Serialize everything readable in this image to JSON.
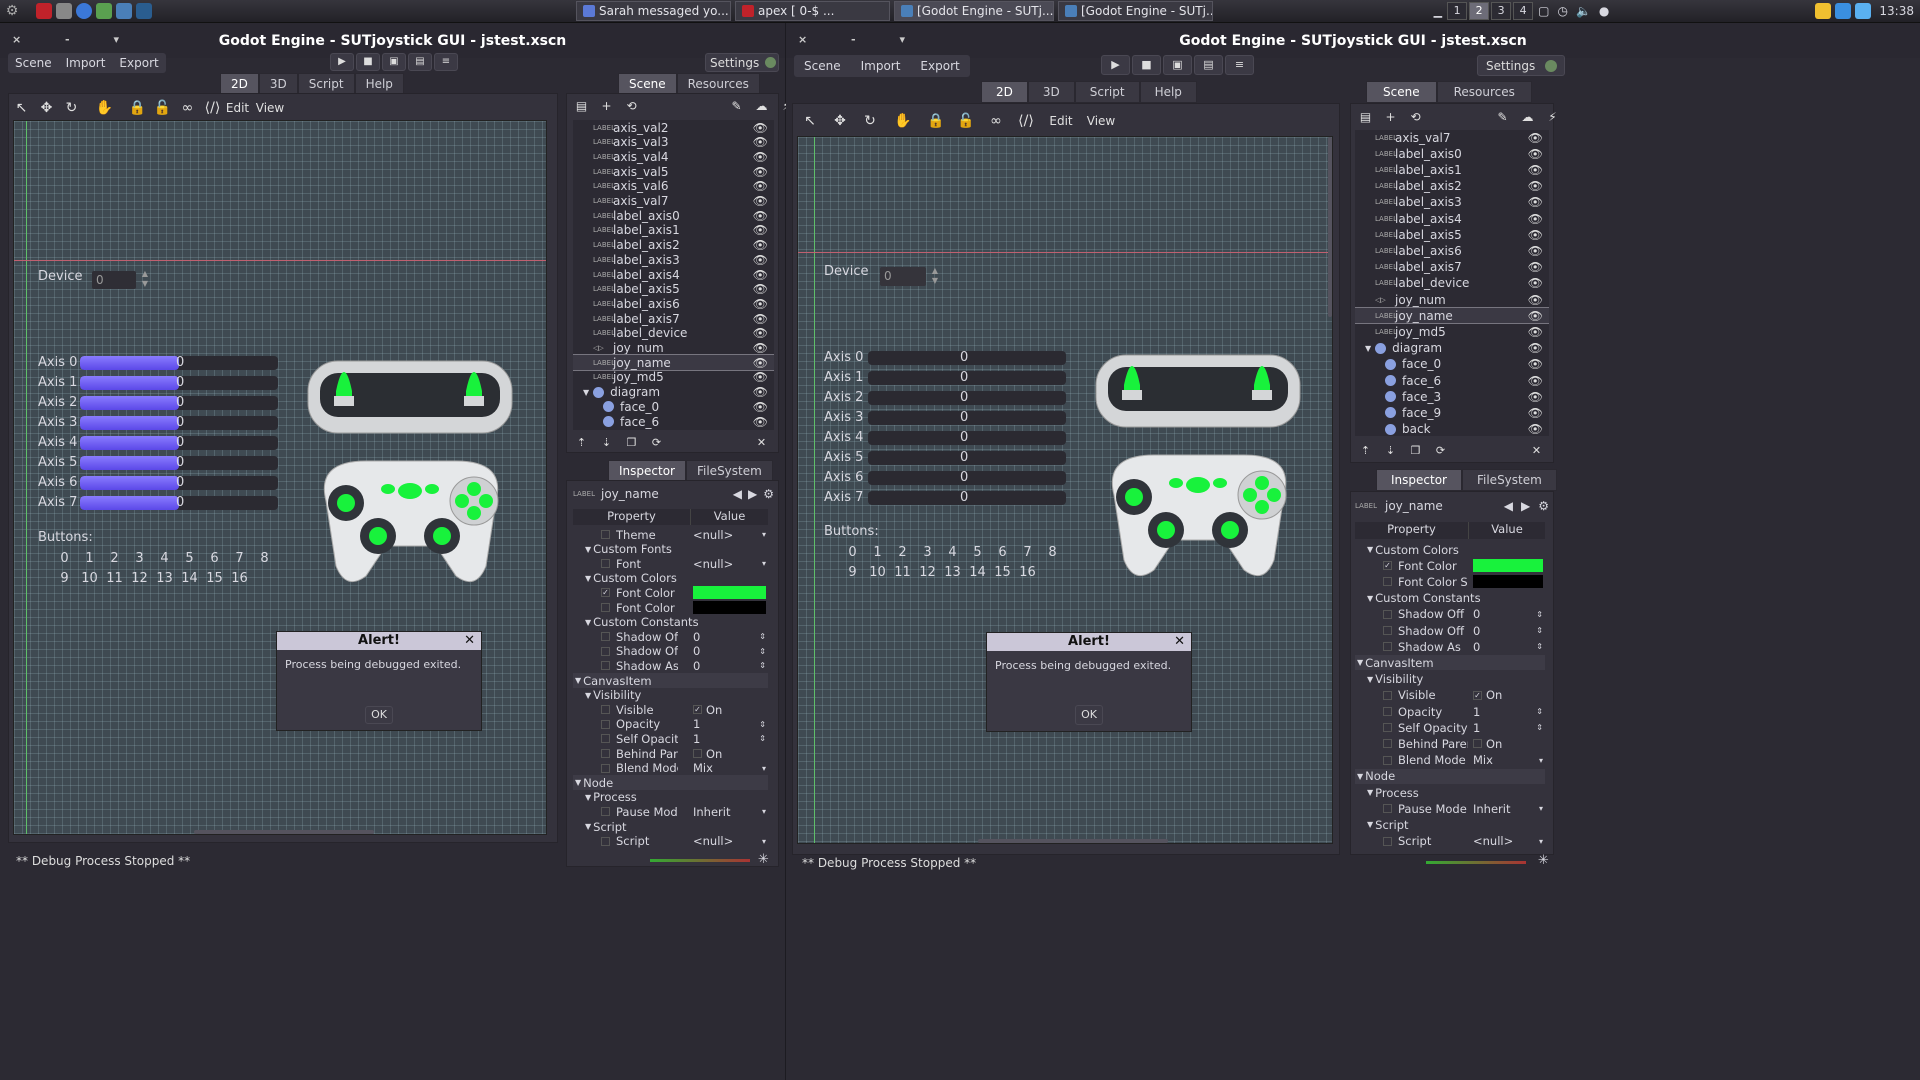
{
  "taskbar": {
    "tasks": [
      "Sarah messaged yo...",
      "apex [          0-$   ...",
      "[Godot Engine - SUTj...",
      "[Godot Engine - SUTj..."
    ],
    "workspaces": [
      "1",
      "2",
      "3",
      "4"
    ],
    "clock": "13:38"
  },
  "left": {
    "title": "Godot Engine - SUTjoystick GUI - jstest.xscn",
    "menu": [
      "Scene",
      "Import",
      "Export"
    ],
    "settings": "Settings",
    "modes": [
      "2D",
      "3D",
      "Script",
      "Help"
    ],
    "toolbar_menu": [
      "Edit",
      "View"
    ],
    "scene_tabs": [
      "Scene",
      "Resources"
    ],
    "tree": [
      {
        "label": "axis_val2",
        "type": "LABEL"
      },
      {
        "label": "axis_val3",
        "type": "LABEL"
      },
      {
        "label": "axis_val4",
        "type": "LABEL"
      },
      {
        "label": "axis_val5",
        "type": "LABEL"
      },
      {
        "label": "axis_val6",
        "type": "LABEL"
      },
      {
        "label": "axis_val7",
        "type": "LABEL"
      },
      {
        "label": "label_axis0",
        "type": "LABEL"
      },
      {
        "label": "label_axis1",
        "type": "LABEL"
      },
      {
        "label": "label_axis2",
        "type": "LABEL"
      },
      {
        "label": "label_axis3",
        "type": "LABEL"
      },
      {
        "label": "label_axis4",
        "type": "LABEL"
      },
      {
        "label": "label_axis5",
        "type": "LABEL"
      },
      {
        "label": "label_axis6",
        "type": "LABEL"
      },
      {
        "label": "label_axis7",
        "type": "LABEL"
      },
      {
        "label": "label_device",
        "type": "LABEL"
      },
      {
        "label": "joy_num",
        "type": "SPIN"
      },
      {
        "label": "joy_name",
        "type": "LABEL"
      },
      {
        "label": "joy_md5",
        "type": "LABEL"
      },
      {
        "label": "diagram",
        "type": "NODE"
      },
      {
        "label": "face_0",
        "type": "NODE"
      },
      {
        "label": "face_6",
        "type": "NODE"
      }
    ],
    "inspector_tabs": [
      "Inspector",
      "FileSystem"
    ],
    "inspector_node": "joy_name",
    "columns": [
      "Property",
      "Value"
    ],
    "props": [
      [
        "Theme",
        "<null>"
      ],
      [
        "Custom Fonts",
        ""
      ],
      [
        "Font",
        "<null>"
      ],
      [
        "Custom Colors",
        ""
      ],
      [
        "Font Color",
        ""
      ],
      [
        "Font Color S",
        ""
      ],
      [
        "Custom Constants",
        ""
      ],
      [
        "Shadow Offs",
        "0"
      ],
      [
        "Shadow Offs",
        "0"
      ],
      [
        "Shadow As",
        "0"
      ],
      [
        "CanvasItem",
        ""
      ],
      [
        "Visibility",
        ""
      ],
      [
        "Visible",
        "On"
      ],
      [
        "Opacity",
        "1"
      ],
      [
        "Self Opacity",
        "1"
      ],
      [
        "Behind Parent",
        "On"
      ],
      [
        "Blend Mode",
        "Mix"
      ],
      [
        "Node",
        ""
      ],
      [
        "Process",
        ""
      ],
      [
        "Pause Mode",
        "Inherit"
      ],
      [
        "Script",
        ""
      ],
      [
        "Script",
        "<null>"
      ]
    ],
    "status": "** Debug Process Stopped **"
  },
  "right": {
    "title": "Godot Engine - SUTjoystick GUI - jstest.xscn",
    "menu": [
      "Scene",
      "Import",
      "Export"
    ],
    "settings": "Settings",
    "modes": [
      "2D",
      "3D",
      "Script",
      "Help"
    ],
    "toolbar_menu": [
      "Edit",
      "View"
    ],
    "scene_tabs": [
      "Scene",
      "Resources"
    ],
    "tree": [
      {
        "label": "axis_val7",
        "type": "LABEL"
      },
      {
        "label": "label_axis0",
        "type": "LABEL"
      },
      {
        "label": "label_axis1",
        "type": "LABEL"
      },
      {
        "label": "label_axis2",
        "type": "LABEL"
      },
      {
        "label": "label_axis3",
        "type": "LABEL"
      },
      {
        "label": "label_axis4",
        "type": "LABEL"
      },
      {
        "label": "label_axis5",
        "type": "LABEL"
      },
      {
        "label": "label_axis6",
        "type": "LABEL"
      },
      {
        "label": "label_axis7",
        "type": "LABEL"
      },
      {
        "label": "label_device",
        "type": "LABEL"
      },
      {
        "label": "joy_num",
        "type": "SPIN"
      },
      {
        "label": "joy_name",
        "type": "LABEL"
      },
      {
        "label": "joy_md5",
        "type": "LABEL"
      },
      {
        "label": "diagram",
        "type": "NODE"
      },
      {
        "label": "face_0",
        "type": "NODE"
      },
      {
        "label": "face_6",
        "type": "NODE"
      },
      {
        "label": "face_3",
        "type": "NODE"
      },
      {
        "label": "face_9",
        "type": "NODE"
      },
      {
        "label": "back",
        "type": "NODE"
      }
    ],
    "inspector_tabs": [
      "Inspector",
      "FileSystem"
    ],
    "inspector_node": "joy_name",
    "columns": [
      "Property",
      "Value"
    ],
    "props": [
      [
        "Custom Colors",
        ""
      ],
      [
        "Font Color",
        ""
      ],
      [
        "Font Color S",
        ""
      ],
      [
        "Custom Constants",
        ""
      ],
      [
        "Shadow Off",
        "0"
      ],
      [
        "Shadow Off",
        "0"
      ],
      [
        "Shadow As",
        "0"
      ],
      [
        "CanvasItem",
        ""
      ],
      [
        "Visibility",
        ""
      ],
      [
        "Visible",
        "On"
      ],
      [
        "Opacity",
        "1"
      ],
      [
        "Self Opacity",
        "1"
      ],
      [
        "Behind Parent",
        "On"
      ],
      [
        "Blend Mode",
        "Mix"
      ],
      [
        "Node",
        ""
      ],
      [
        "Process",
        ""
      ],
      [
        "Pause Mode",
        "Inherit"
      ],
      [
        "Script",
        ""
      ],
      [
        "Script",
        "<null>"
      ]
    ],
    "status": "** Debug Process Stopped **"
  },
  "game": {
    "device_label": "Device",
    "device_value": "0",
    "axes": [
      "Axis 0",
      "Axis 1",
      "Axis 2",
      "Axis 3",
      "Axis 4",
      "Axis 5",
      "Axis 6",
      "Axis 7"
    ],
    "axis_values": [
      "0",
      "0",
      "0",
      "0",
      "0",
      "0",
      "0",
      "0"
    ],
    "left_axis_fill": [
      0.5,
      0.5,
      0.5,
      0.5,
      0.5,
      0.5,
      0.5,
      0.5
    ],
    "right_axis_fill": [
      0,
      0,
      0,
      0,
      0,
      0,
      0,
      0
    ],
    "buttons_label": "Buttons:",
    "buttons_row1": [
      "0",
      "1",
      "2",
      "3",
      "4",
      "5",
      "6",
      "7",
      "8"
    ],
    "buttons_row2": [
      "9",
      "10",
      "11",
      "12",
      "13",
      "14",
      "15",
      "16"
    ]
  },
  "alert": {
    "title": "Alert!",
    "message": "Process being debugged exited.",
    "ok": "OK"
  },
  "colors": {
    "accent_green": "#18f23c",
    "axis_purple": "#6a58f0"
  }
}
